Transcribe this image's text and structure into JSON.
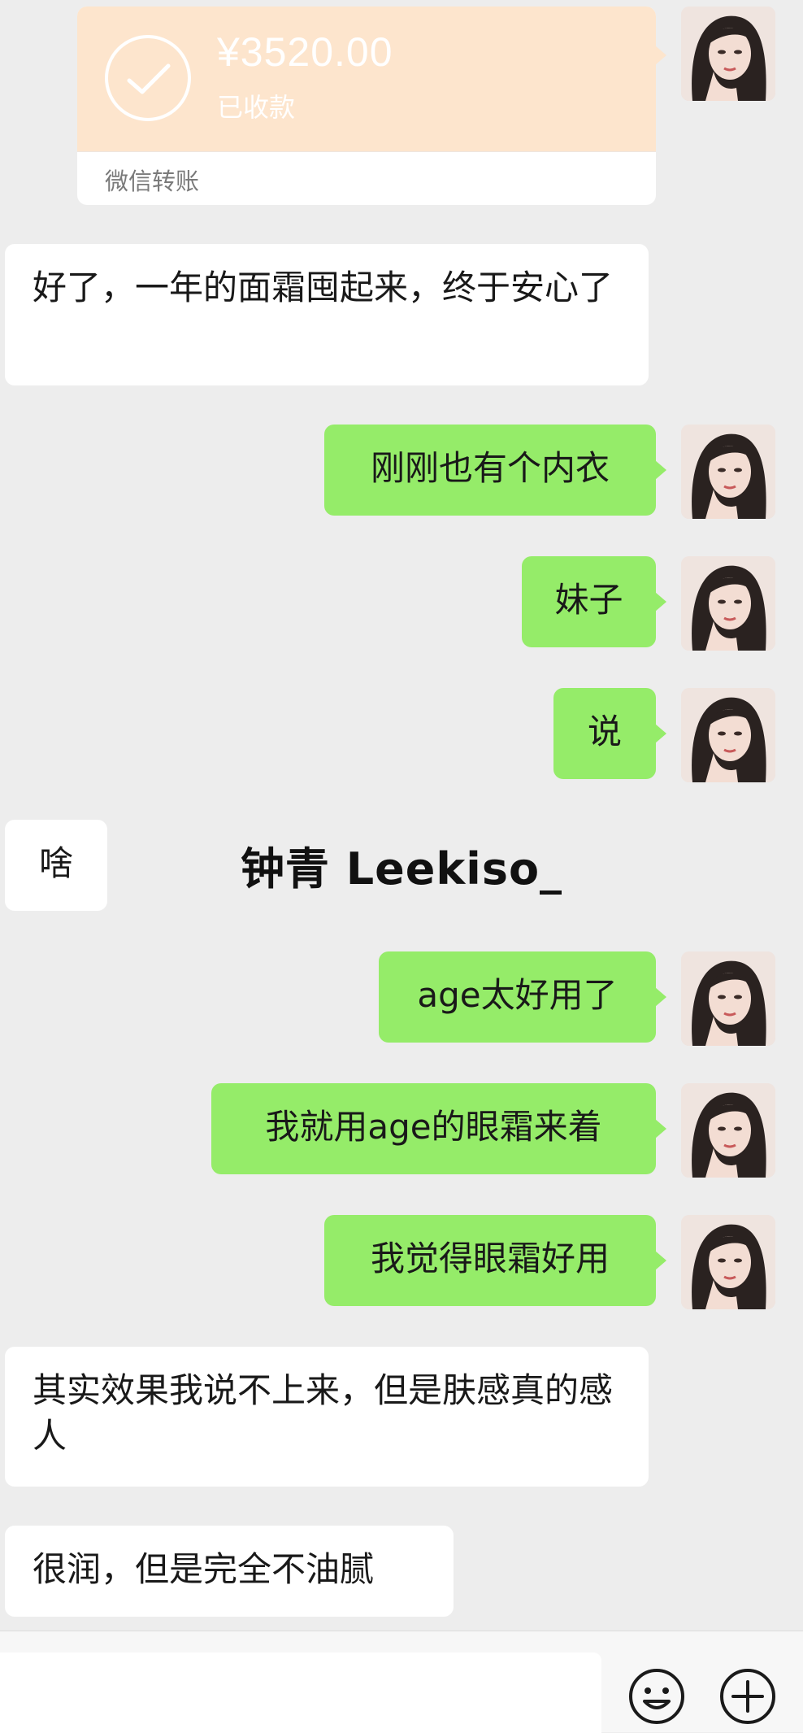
{
  "transfer": {
    "amount": "¥3520.00",
    "status": "已收款",
    "label": "微信转账"
  },
  "messages": [
    {
      "side": "in",
      "text": "好了，一年的面霜囤起来，终于安心了"
    },
    {
      "side": "out",
      "text": "刚刚也有个内衣"
    },
    {
      "side": "out",
      "text": "妹子"
    },
    {
      "side": "out",
      "text": "说"
    },
    {
      "side": "in",
      "text": "啥"
    },
    {
      "side": "out",
      "text": "age太好用了"
    },
    {
      "side": "out",
      "text": "我就用age的眼霜来着"
    },
    {
      "side": "out",
      "text": "我觉得眼霜好用"
    },
    {
      "side": "in",
      "text": "其实效果我说不上来，但是肤感真的感人"
    },
    {
      "side": "in",
      "text": "很润，但是完全不油腻"
    }
  ],
  "watermark": "钟青 Leekiso_",
  "input_bar": {
    "icons": [
      "emoji-icon",
      "plus-icon"
    ]
  },
  "colors": {
    "background": "#ededed",
    "bubble_out": "#95ec69",
    "bubble_in": "#ffffff",
    "transfer_card": "#fde5cd"
  }
}
